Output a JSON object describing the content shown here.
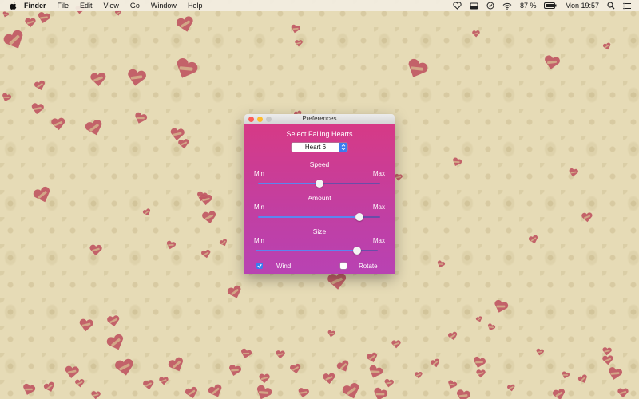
{
  "menubar": {
    "apple_icon": "apple-logo-icon",
    "items": [
      "Finder",
      "File",
      "Edit",
      "View",
      "Go",
      "Window",
      "Help"
    ],
    "status": {
      "icons": [
        "heart-icon",
        "tray-icon",
        "checkbox-icon",
        "wifi-icon",
        "battery-icon",
        "search-icon",
        "list-icon"
      ],
      "battery_text": "87 %",
      "clock": "Mon 19:57"
    }
  },
  "prefs": {
    "title": "Preferences",
    "select_label": "Select Falling Hearts",
    "select_value": "Heart 6",
    "sliders": [
      {
        "label": "Speed",
        "min": "Min",
        "max": "Max",
        "value": 0.5
      },
      {
        "label": "Amount",
        "min": "Min",
        "max": "Max",
        "value": 0.83
      },
      {
        "label": "Size",
        "min": "Min",
        "max": "Max",
        "value": 0.83
      }
    ],
    "wind": {
      "label": "Wind",
      "checked": true
    },
    "rotate": {
      "label": "Rotate",
      "checked": false
    }
  },
  "colors": {
    "heart": "#c05863",
    "panel_top": "#d63a86",
    "panel_bottom": "#b842b3",
    "accent": "#3a7cf0"
  }
}
